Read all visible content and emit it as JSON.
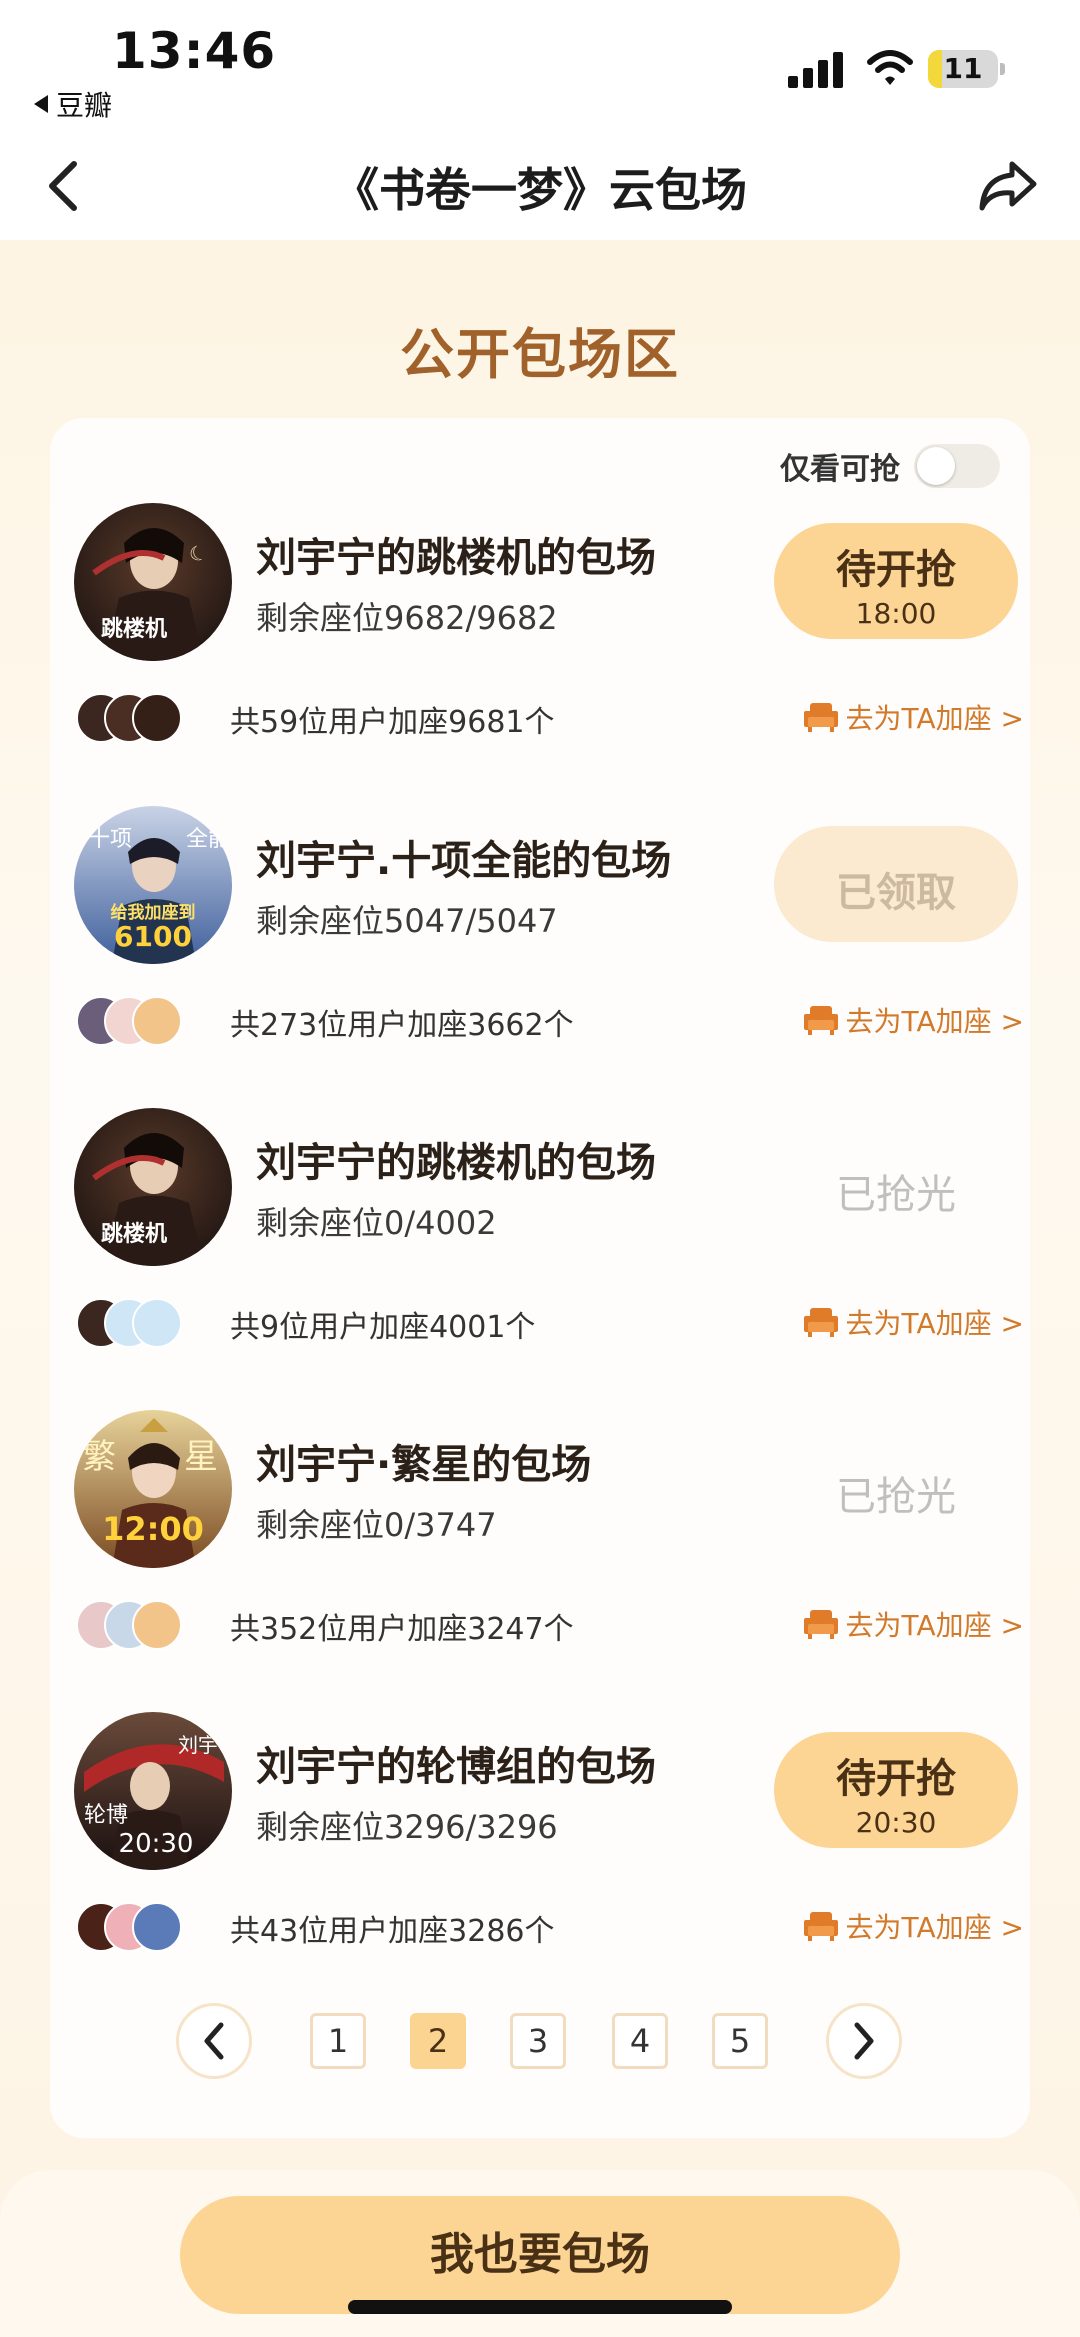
{
  "status": {
    "time": "13:46",
    "back_app": "豆瓣",
    "battery": "11"
  },
  "nav": {
    "title": "《书卷一梦》云包场"
  },
  "section_title": "公开包场区",
  "filter": {
    "label": "仅看可抢"
  },
  "items": [
    {
      "title": "刘宇宁的跳楼机的包场",
      "seats": "剩余座位9682/9682",
      "action_label": "待开抢",
      "action_time": "18:00",
      "joiners": "共59位用户加座9681个",
      "seat_link": "去为TA加座 >"
    },
    {
      "title": "刘宇宁.十项全能的包场",
      "seats": "剩余座位5047/5047",
      "action_label": "已领取",
      "action_time": "",
      "joiners": "共273位用户加座3662个",
      "seat_link": "去为TA加座 >"
    },
    {
      "title": "刘宇宁的跳楼机的包场",
      "seats": "剩余座位0/4002",
      "action_label": "已抢光",
      "action_time": "",
      "joiners": "共9位用户加座4001个",
      "seat_link": "去为TA加座 >"
    },
    {
      "title": "刘宇宁·繁星的包场",
      "seats": "剩余座位0/3747",
      "action_label": "已抢光",
      "action_time": "",
      "joiners": "共352位用户加座3247个",
      "seat_link": "去为TA加座 >"
    },
    {
      "title": "刘宇宁的轮博组的包场",
      "seats": "剩余座位3296/3296",
      "action_label": "待开抢",
      "action_time": "20:30",
      "joiners": "共43位用户加座3286个",
      "seat_link": "去为TA加座 >"
    }
  ],
  "avatar_text": {
    "a1": "跳楼机",
    "a2_top_left": "十项",
    "a2_top_right": "全能",
    "a2_line1": "给我加座到",
    "a2_line2": "6100",
    "a3": "跳楼机",
    "a4_left": "繁",
    "a4_right": "星",
    "a4_time": "12:00",
    "a5_left": "轮博",
    "a5_right": "刘宇宁",
    "a5_time": "20:30"
  },
  "pagination": {
    "pages": [
      "1",
      "2",
      "3",
      "4",
      "5"
    ],
    "current": "2"
  },
  "cta": {
    "label": "我也要包场"
  },
  "colors": {
    "accent": "#fcd594",
    "brand_text": "#a0622a",
    "link": "#d27a2b",
    "background": "#fdf4e3"
  }
}
